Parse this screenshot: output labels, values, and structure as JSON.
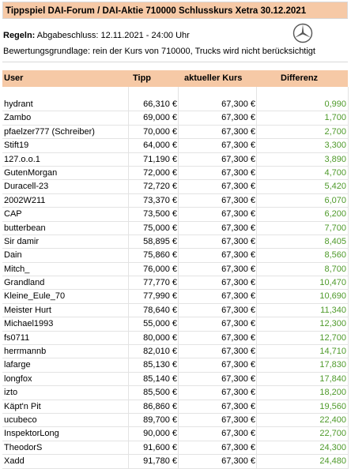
{
  "title": "Tippspiel DAI-Forum / DAI-Aktie 710000 Schlusskurs Xetra 30.12.2021",
  "rules": {
    "label": "Regeln:",
    "text": "Abgabeschluss: 12.11.2021 - 24:00 Uhr",
    "basis": "Bewertungsgrundlage: rein der Kurs von 710000, Trucks wird nicht berücksichtigt"
  },
  "logo_icon": "mercedes-star-icon",
  "colors": {
    "header_bg": "#f6c9a6",
    "diff_text": "#4e9a2a"
  },
  "table": {
    "headers": {
      "user": "User",
      "tipp": "Tipp",
      "kurs": "aktueller Kurs",
      "diff": "Differenz"
    },
    "rows": [
      {
        "user": "hydrant",
        "tipp": "66,310 €",
        "kurs": "67,300 €",
        "diff": "0,990"
      },
      {
        "user": "Zambo",
        "tipp": "69,000 €",
        "kurs": "67,300 €",
        "diff": "1,700"
      },
      {
        "user": "pfaelzer777 (Schreiber)",
        "tipp": "70,000 €",
        "kurs": "67,300 €",
        "diff": "2,700"
      },
      {
        "user": "Stift19",
        "tipp": "64,000 €",
        "kurs": "67,300 €",
        "diff": "3,300"
      },
      {
        "user": "127.o.o.1",
        "tipp": "71,190 €",
        "kurs": "67,300 €",
        "diff": "3,890"
      },
      {
        "user": "GutenMorgan",
        "tipp": "72,000 €",
        "kurs": "67,300 €",
        "diff": "4,700"
      },
      {
        "user": "Duracell-23",
        "tipp": "72,720 €",
        "kurs": "67,300 €",
        "diff": "5,420"
      },
      {
        "user": "2002W211",
        "tipp": "73,370 €",
        "kurs": "67,300 €",
        "diff": "6,070"
      },
      {
        "user": "CAP",
        "tipp": "73,500 €",
        "kurs": "67,300 €",
        "diff": "6,200"
      },
      {
        "user": "butterbean",
        "tipp": "75,000 €",
        "kurs": "67,300 €",
        "diff": "7,700"
      },
      {
        "user": "Sir damir",
        "tipp": "58,895 €",
        "kurs": "67,300 €",
        "diff": "8,405"
      },
      {
        "user": "Dain",
        "tipp": "75,860 €",
        "kurs": "67,300 €",
        "diff": "8,560"
      },
      {
        "user": "Mitch_",
        "tipp": "76,000 €",
        "kurs": "67,300 €",
        "diff": "8,700"
      },
      {
        "user": "Grandland",
        "tipp": "77,770 €",
        "kurs": "67,300 €",
        "diff": "10,470"
      },
      {
        "user": "Kleine_Eule_70",
        "tipp": "77,990 €",
        "kurs": "67,300 €",
        "diff": "10,690"
      },
      {
        "user": "Meister Hurt",
        "tipp": "78,640 €",
        "kurs": "67,300 €",
        "diff": "11,340"
      },
      {
        "user": "Michael1993",
        "tipp": "55,000 €",
        "kurs": "67,300 €",
        "diff": "12,300"
      },
      {
        "user": "fs0711",
        "tipp": "80,000 €",
        "kurs": "67,300 €",
        "diff": "12,700"
      },
      {
        "user": "herrmannb",
        "tipp": "82,010 €",
        "kurs": "67,300 €",
        "diff": "14,710"
      },
      {
        "user": "lafarge",
        "tipp": "85,130 €",
        "kurs": "67,300 €",
        "diff": "17,830"
      },
      {
        "user": "longfox",
        "tipp": "85,140 €",
        "kurs": "67,300 €",
        "diff": "17,840"
      },
      {
        "user": "izto",
        "tipp": "85,500 €",
        "kurs": "67,300 €",
        "diff": "18,200"
      },
      {
        "user": "Käpt'n Pit",
        "tipp": "86,860 €",
        "kurs": "67,300 €",
        "diff": "19,560"
      },
      {
        "user": "ucubeco",
        "tipp": "89,700 €",
        "kurs": "67,300 €",
        "diff": "22,400"
      },
      {
        "user": "InspektorLong",
        "tipp": "90,000 €",
        "kurs": "67,300 €",
        "diff": "22,700"
      },
      {
        "user": "TheodorS",
        "tipp": "91,600 €",
        "kurs": "67,300 €",
        "diff": "24,300"
      },
      {
        "user": "Xadd",
        "tipp": "91,780 €",
        "kurs": "67,300 €",
        "diff": "24,480"
      }
    ]
  }
}
